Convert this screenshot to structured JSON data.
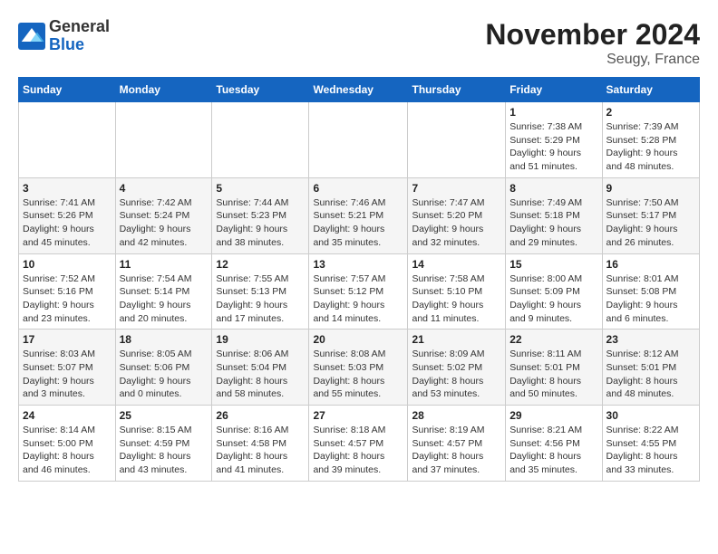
{
  "logo": {
    "general": "General",
    "blue": "Blue"
  },
  "title": "November 2024",
  "location": "Seugy, France",
  "headers": [
    "Sunday",
    "Monday",
    "Tuesday",
    "Wednesday",
    "Thursday",
    "Friday",
    "Saturday"
  ],
  "weeks": [
    [
      {
        "day": "",
        "info": ""
      },
      {
        "day": "",
        "info": ""
      },
      {
        "day": "",
        "info": ""
      },
      {
        "day": "",
        "info": ""
      },
      {
        "day": "",
        "info": ""
      },
      {
        "day": "1",
        "info": "Sunrise: 7:38 AM\nSunset: 5:29 PM\nDaylight: 9 hours\nand 51 minutes."
      },
      {
        "day": "2",
        "info": "Sunrise: 7:39 AM\nSunset: 5:28 PM\nDaylight: 9 hours\nand 48 minutes."
      }
    ],
    [
      {
        "day": "3",
        "info": "Sunrise: 7:41 AM\nSunset: 5:26 PM\nDaylight: 9 hours\nand 45 minutes."
      },
      {
        "day": "4",
        "info": "Sunrise: 7:42 AM\nSunset: 5:24 PM\nDaylight: 9 hours\nand 42 minutes."
      },
      {
        "day": "5",
        "info": "Sunrise: 7:44 AM\nSunset: 5:23 PM\nDaylight: 9 hours\nand 38 minutes."
      },
      {
        "day": "6",
        "info": "Sunrise: 7:46 AM\nSunset: 5:21 PM\nDaylight: 9 hours\nand 35 minutes."
      },
      {
        "day": "7",
        "info": "Sunrise: 7:47 AM\nSunset: 5:20 PM\nDaylight: 9 hours\nand 32 minutes."
      },
      {
        "day": "8",
        "info": "Sunrise: 7:49 AM\nSunset: 5:18 PM\nDaylight: 9 hours\nand 29 minutes."
      },
      {
        "day": "9",
        "info": "Sunrise: 7:50 AM\nSunset: 5:17 PM\nDaylight: 9 hours\nand 26 minutes."
      }
    ],
    [
      {
        "day": "10",
        "info": "Sunrise: 7:52 AM\nSunset: 5:16 PM\nDaylight: 9 hours\nand 23 minutes."
      },
      {
        "day": "11",
        "info": "Sunrise: 7:54 AM\nSunset: 5:14 PM\nDaylight: 9 hours\nand 20 minutes."
      },
      {
        "day": "12",
        "info": "Sunrise: 7:55 AM\nSunset: 5:13 PM\nDaylight: 9 hours\nand 17 minutes."
      },
      {
        "day": "13",
        "info": "Sunrise: 7:57 AM\nSunset: 5:12 PM\nDaylight: 9 hours\nand 14 minutes."
      },
      {
        "day": "14",
        "info": "Sunrise: 7:58 AM\nSunset: 5:10 PM\nDaylight: 9 hours\nand 11 minutes."
      },
      {
        "day": "15",
        "info": "Sunrise: 8:00 AM\nSunset: 5:09 PM\nDaylight: 9 hours\nand 9 minutes."
      },
      {
        "day": "16",
        "info": "Sunrise: 8:01 AM\nSunset: 5:08 PM\nDaylight: 9 hours\nand 6 minutes."
      }
    ],
    [
      {
        "day": "17",
        "info": "Sunrise: 8:03 AM\nSunset: 5:07 PM\nDaylight: 9 hours\nand 3 minutes."
      },
      {
        "day": "18",
        "info": "Sunrise: 8:05 AM\nSunset: 5:06 PM\nDaylight: 9 hours\nand 0 minutes."
      },
      {
        "day": "19",
        "info": "Sunrise: 8:06 AM\nSunset: 5:04 PM\nDaylight: 8 hours\nand 58 minutes."
      },
      {
        "day": "20",
        "info": "Sunrise: 8:08 AM\nSunset: 5:03 PM\nDaylight: 8 hours\nand 55 minutes."
      },
      {
        "day": "21",
        "info": "Sunrise: 8:09 AM\nSunset: 5:02 PM\nDaylight: 8 hours\nand 53 minutes."
      },
      {
        "day": "22",
        "info": "Sunrise: 8:11 AM\nSunset: 5:01 PM\nDaylight: 8 hours\nand 50 minutes."
      },
      {
        "day": "23",
        "info": "Sunrise: 8:12 AM\nSunset: 5:01 PM\nDaylight: 8 hours\nand 48 minutes."
      }
    ],
    [
      {
        "day": "24",
        "info": "Sunrise: 8:14 AM\nSunset: 5:00 PM\nDaylight: 8 hours\nand 46 minutes."
      },
      {
        "day": "25",
        "info": "Sunrise: 8:15 AM\nSunset: 4:59 PM\nDaylight: 8 hours\nand 43 minutes."
      },
      {
        "day": "26",
        "info": "Sunrise: 8:16 AM\nSunset: 4:58 PM\nDaylight: 8 hours\nand 41 minutes."
      },
      {
        "day": "27",
        "info": "Sunrise: 8:18 AM\nSunset: 4:57 PM\nDaylight: 8 hours\nand 39 minutes."
      },
      {
        "day": "28",
        "info": "Sunrise: 8:19 AM\nSunset: 4:57 PM\nDaylight: 8 hours\nand 37 minutes."
      },
      {
        "day": "29",
        "info": "Sunrise: 8:21 AM\nSunset: 4:56 PM\nDaylight: 8 hours\nand 35 minutes."
      },
      {
        "day": "30",
        "info": "Sunrise: 8:22 AM\nSunset: 4:55 PM\nDaylight: 8 hours\nand 33 minutes."
      }
    ]
  ]
}
